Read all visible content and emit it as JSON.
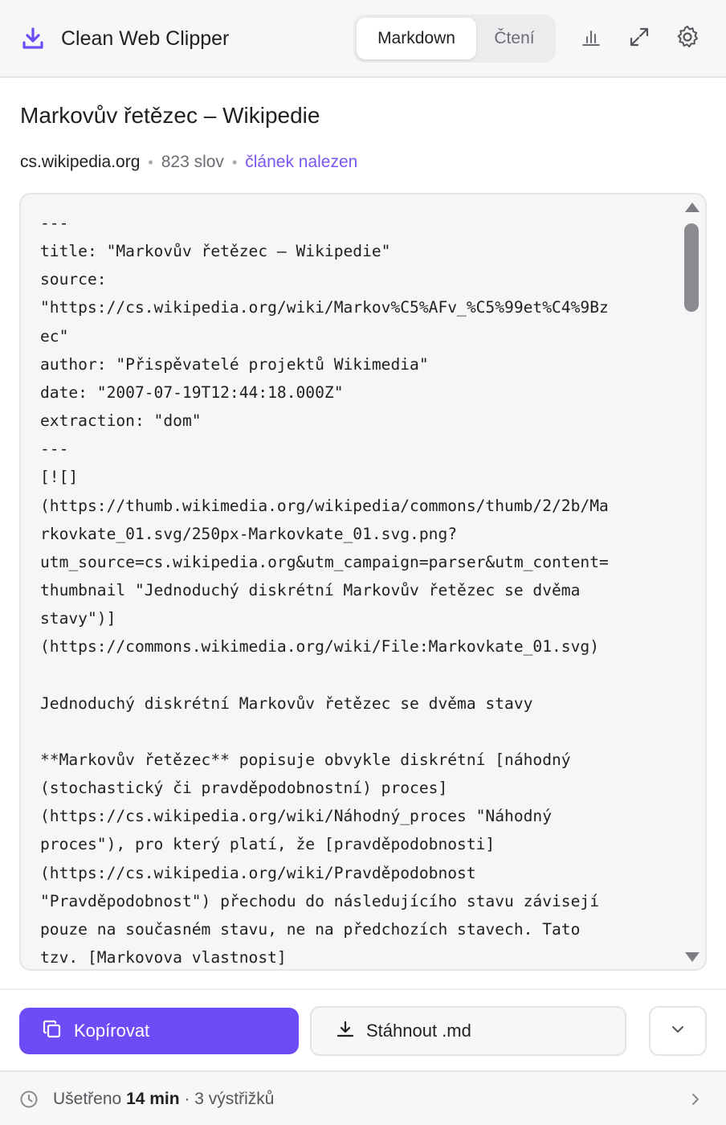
{
  "app": {
    "title": "Clean Web Clipper",
    "accent_color": "#6d4cf6"
  },
  "header": {
    "logo_icon": "download-tray-icon",
    "mode_tabs": [
      {
        "label": "Markdown",
        "active": true
      },
      {
        "label": "Čtení",
        "active": false
      }
    ],
    "actions": [
      {
        "icon": "bar-chart-icon"
      },
      {
        "icon": "expand-icon"
      },
      {
        "icon": "gear-icon"
      }
    ]
  },
  "article": {
    "title": "Markovův řetězec – Wikipedie",
    "domain": "cs.wikipedia.org",
    "separator": "•",
    "word_count": "823 slov",
    "status": "článek nalezen"
  },
  "editor": {
    "lines": [
      "---",
      "title: \"Markovův řetězec – Wikipedie\"",
      "source:",
      "\"https://cs.wikipedia.org/wiki/Markov%C5%AFv_%C5%99et%C4%9Bz",
      "ec\"",
      "author: \"Přispěvatelé projektů Wikimedia\"",
      "date: \"2007-07-19T12:44:18.000Z\"",
      "extraction: \"dom\"",
      "---",
      "[![]",
      "(https://thumb.wikimedia.org/wikipedia/commons/thumb/2/2b/Ma",
      "rkovkate_01.svg/250px-Markovkate_01.svg.png?",
      "utm_source=cs.wikipedia.org&utm_campaign=parser&utm_content=",
      "thumbnail \"Jednoduchý diskrétní Markovův řetězec se dvěma",
      "stavy\")]",
      "(https://commons.wikimedia.org/wiki/File:Markovkate_01.svg)",
      "",
      "Jednoduchý diskrétní Markovův řetězec se dvěma stavy",
      "",
      "**Markovův řetězec** popisuje obvykle diskrétní [náhodný",
      "(stochastický či pravděpodobnostní) proces]",
      "(https://cs.wikipedia.org/wiki/Náhodný_proces \"Náhodný",
      "proces\"), pro který platí, že [pravděpodobnosti]",
      "(https://cs.wikipedia.org/wiki/Pravděpodobnost",
      "\"Pravděpodobnost\") přechodu do následujícího stavu závisejí",
      "pouze na současném stavu, ne na předchozích stavech. Tato",
      "tzv. [Markovova vlastnost]"
    ],
    "scroll_position": 0.0
  },
  "actions": {
    "copy_label": "Kopírovat",
    "copy_icon": "copy-icon",
    "download_label": "Stáhnout .md",
    "download_icon": "download-icon",
    "more_icon": "chevron-down-icon"
  },
  "footer": {
    "icon": "clock-icon",
    "saved_prefix": "Ušetřeno",
    "saved_time": "14 min",
    "clips_text": "· 3 výstřižků",
    "chevron_icon": "chevron-right-icon"
  }
}
